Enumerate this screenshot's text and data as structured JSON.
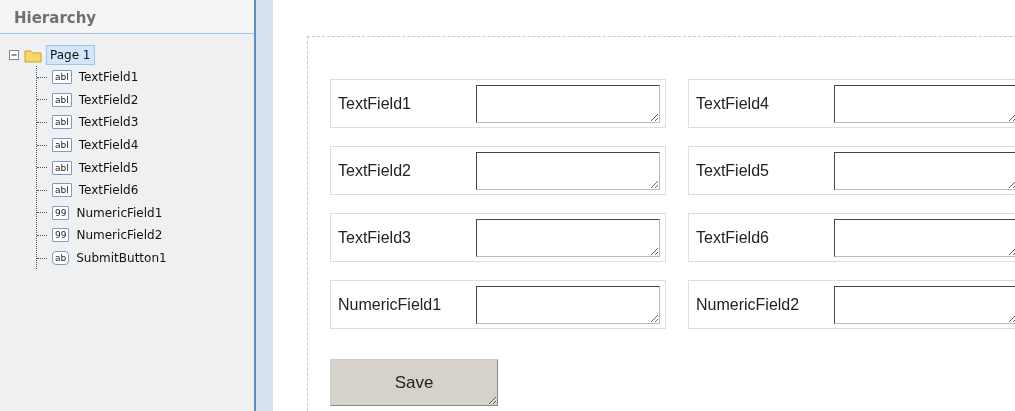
{
  "hierarchy": {
    "title": "Hierarchy",
    "root": {
      "label": "Page 1",
      "expanded": true,
      "selected": true,
      "children": [
        {
          "label": "TextField1",
          "kind": "text",
          "badge": "abl",
          "selected": false
        },
        {
          "label": "TextField2",
          "kind": "text",
          "badge": "abl",
          "selected": false
        },
        {
          "label": "TextField3",
          "kind": "text",
          "badge": "abl",
          "selected": false
        },
        {
          "label": "TextField4",
          "kind": "text",
          "badge": "abl",
          "selected": false
        },
        {
          "label": "TextField5",
          "kind": "text",
          "badge": "abl",
          "selected": false
        },
        {
          "label": "TextField6",
          "kind": "text",
          "badge": "abl",
          "selected": false
        },
        {
          "label": "NumericField1",
          "kind": "numeric",
          "badge": "99",
          "selected": false
        },
        {
          "label": "NumericField2",
          "kind": "numeric",
          "badge": "99",
          "selected": false
        },
        {
          "label": "SubmitButton1",
          "kind": "button",
          "badge": "ab",
          "selected": false
        }
      ]
    }
  },
  "form": {
    "rows": [
      [
        {
          "label": "TextField1"
        },
        {
          "label": "TextField4"
        }
      ],
      [
        {
          "label": "TextField2"
        },
        {
          "label": "TextField5"
        }
      ],
      [
        {
          "label": "TextField3"
        },
        {
          "label": "TextField6"
        }
      ],
      [
        {
          "label": "NumericField1"
        },
        {
          "label": "NumericField2"
        }
      ]
    ],
    "submit": {
      "label": "Save"
    }
  }
}
